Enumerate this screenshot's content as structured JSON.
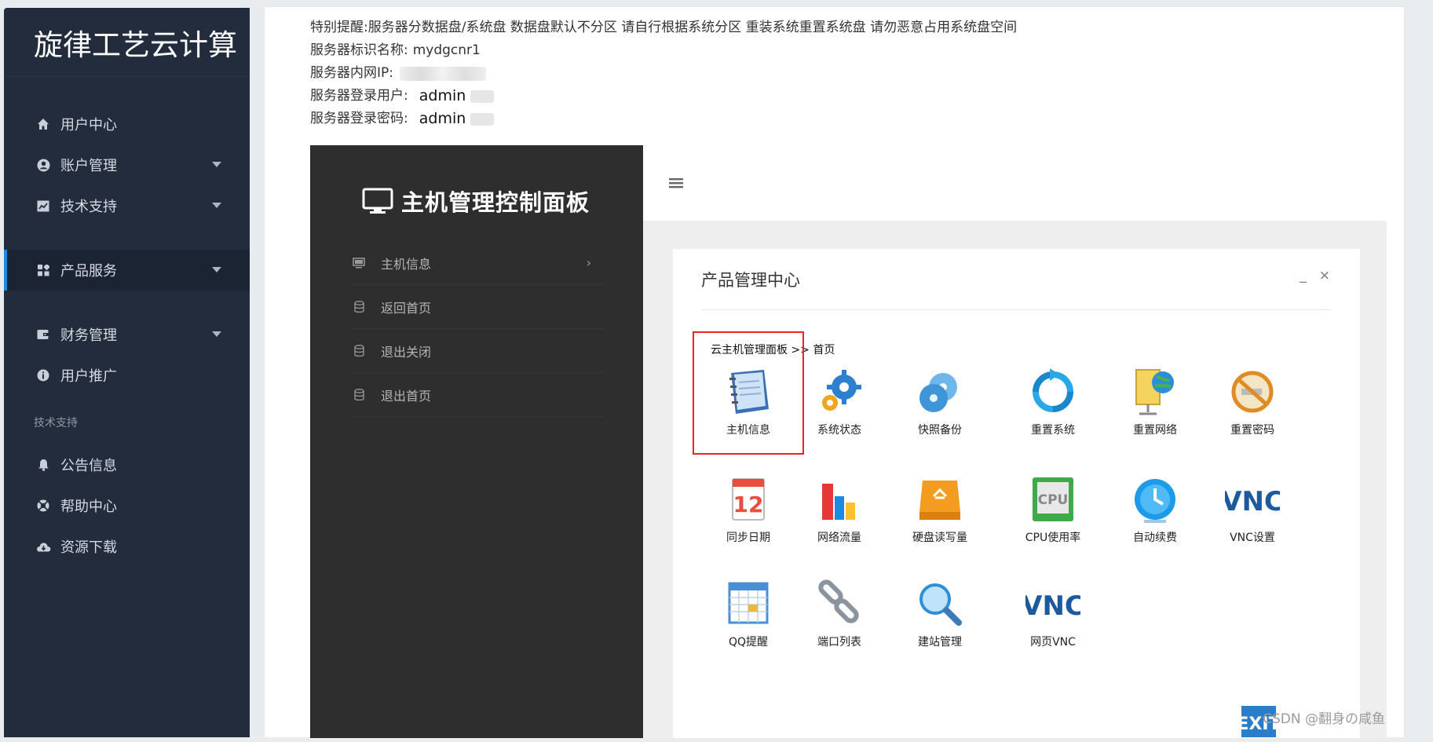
{
  "sidebar": {
    "brand": "旋律工艺云计算",
    "items": [
      {
        "label": "用户中心",
        "icon": "home-icon"
      },
      {
        "label": "账户管理",
        "icon": "user-circle-icon"
      },
      {
        "label": "技术支持",
        "icon": "chart-icon"
      },
      {
        "label": "产品服务",
        "icon": "grid-icon"
      },
      {
        "label": "财务管理",
        "icon": "wallet-icon"
      },
      {
        "label": "用户推广",
        "icon": "info-icon"
      }
    ],
    "section_label": "技术支持",
    "items2": [
      {
        "label": "公告信息",
        "icon": "bell-icon"
      },
      {
        "label": "帮助中心",
        "icon": "lifebuoy-icon"
      },
      {
        "label": "资源下载",
        "icon": "cloud-download-icon"
      }
    ]
  },
  "notes": {
    "line1": "特别提醒:服务器分数据盘/系统盘 数据盘默认不分区 请自行根据系统分区 重装系统重置系统盘 请勿恶意占用系统盘空间",
    "line2_label": "服务器标识名称:",
    "line2_value": "mydgcnr1",
    "line3_label": "服务器内网IP:",
    "line4_label": "服务器登录用户:",
    "line4_value": "admin",
    "line5_label": "服务器登录密码:",
    "line5_value": "admin"
  },
  "panel": {
    "title": "主机管理控制面板",
    "menu": [
      "主机信息",
      "返回首页",
      "退出关闭",
      "退出首页"
    ]
  },
  "card": {
    "title": "产品管理中心",
    "minimize": "_",
    "close": "×",
    "breadcrumb": "云主机管理面板 >> 首页",
    "tiles": [
      "主机信息",
      "系统状态",
      "快照备份",
      "重置系统",
      "重置网络",
      "重置密码",
      "同步日期",
      "网络流量",
      "硬盘读写量",
      "CPU使用率",
      "自动续费",
      "VNC设置",
      "QQ提醒",
      "端口列表",
      "建站管理",
      "网页VNC"
    ],
    "cpu_text": "CPU",
    "calendar_day": "12",
    "vnc_text": "VNC",
    "exit_text": "EXIT"
  },
  "watermark": "CSDN @翻身の咸鱼"
}
